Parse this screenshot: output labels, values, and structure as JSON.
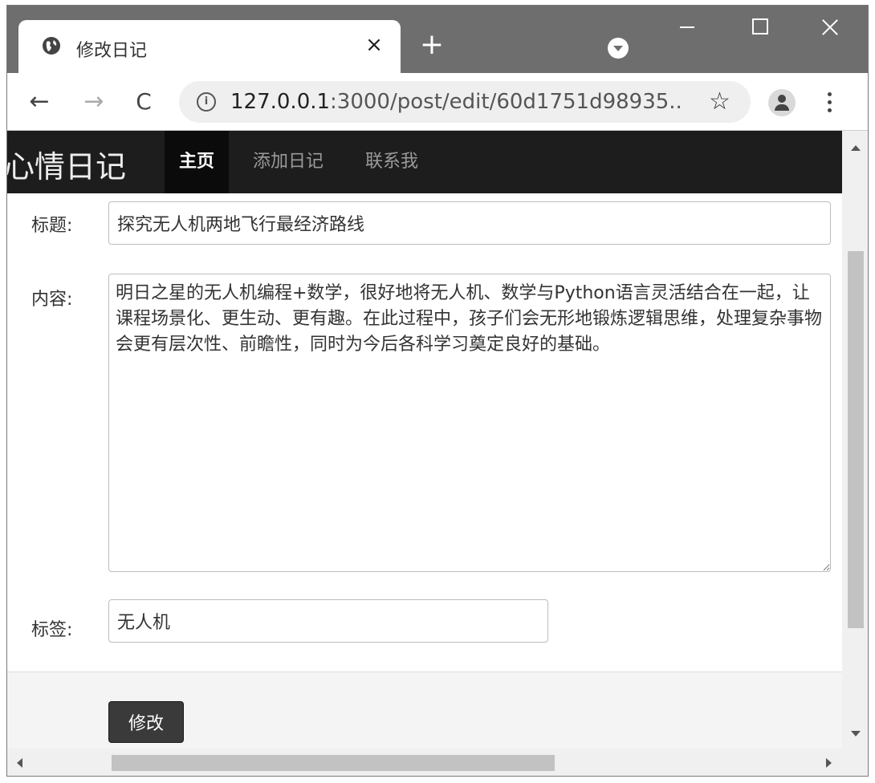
{
  "browser": {
    "tab_title": "修改日记",
    "tab_close": "×",
    "new_tab": "+",
    "url_host": "127.0.0.1",
    "url_path": ":3000/post/edit/60d1751d98935...",
    "icons": {
      "back": "←",
      "forward": "→",
      "reload": "C",
      "info": "i",
      "star": "☆"
    }
  },
  "site": {
    "brand": "心情日记",
    "nav": {
      "home": "主页",
      "add": "添加日记",
      "contact": "联系我"
    }
  },
  "form": {
    "title_label": "标题:",
    "title_value": "探究无人机两地飞行最经济路线",
    "content_label": "内容:",
    "content_value": "明日之星的无人机编程+数学，很好地将无人机、数学与Python语言灵活结合在一起，让课程场景化、更生动、更有趣。在此过程中，孩子们会无形地锻炼逻辑思维，处理复杂事物会更有层次性、前瞻性，同时为今后各科学习奠定良好的基础。",
    "tags_label": "标签:",
    "tags_value": "无人机",
    "submit_label": "修改"
  }
}
